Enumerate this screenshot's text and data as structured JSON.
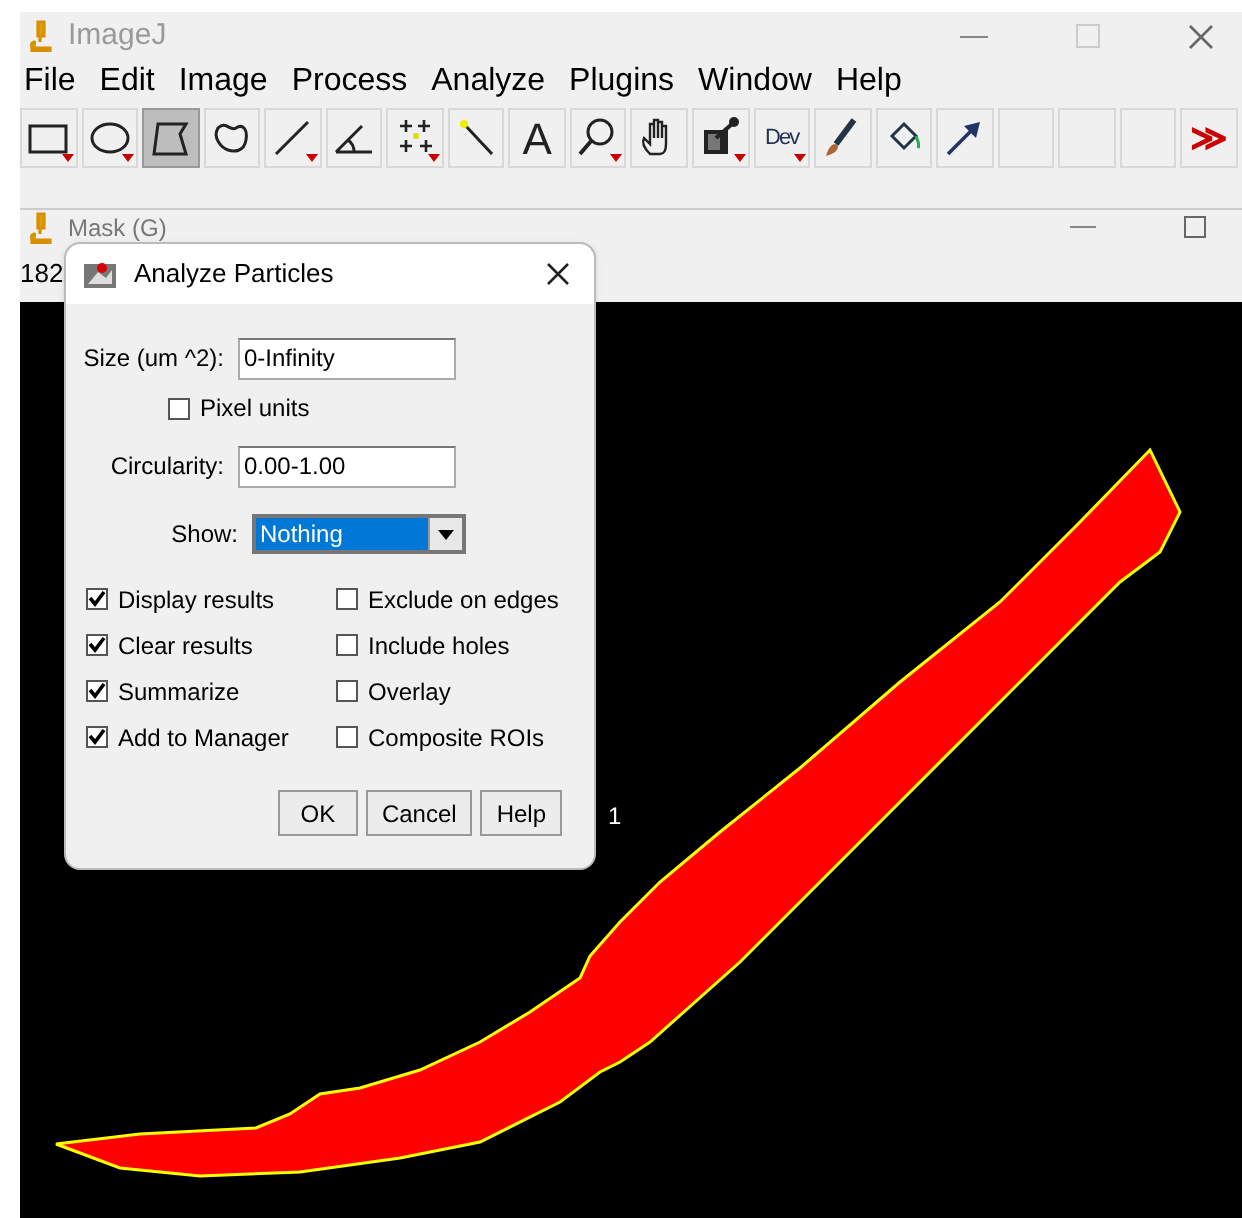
{
  "main_window": {
    "title": "ImageJ"
  },
  "menu": [
    "File",
    "Edit",
    "Image",
    "Process",
    "Analyze",
    "Plugins",
    "Window",
    "Help"
  ],
  "tools": [
    {
      "kind": "rectangle",
      "selected": false,
      "has_menu": true
    },
    {
      "kind": "oval",
      "selected": false,
      "has_menu": true
    },
    {
      "kind": "polygon",
      "selected": true,
      "has_menu": false
    },
    {
      "kind": "freehand",
      "selected": false,
      "has_menu": false
    },
    {
      "kind": "line",
      "selected": false,
      "has_menu": true
    },
    {
      "kind": "angle",
      "selected": false,
      "has_menu": false
    },
    {
      "kind": "points",
      "selected": false,
      "has_menu": true
    },
    {
      "kind": "wand",
      "selected": false,
      "has_menu": false
    },
    {
      "kind": "text",
      "label": "A",
      "selected": false,
      "has_menu": false
    },
    {
      "kind": "magnifier",
      "selected": false,
      "has_menu": true
    },
    {
      "kind": "hand",
      "selected": false,
      "has_menu": false
    },
    {
      "kind": "dropper",
      "selected": false,
      "has_menu": true
    },
    {
      "kind": "dev",
      "label": "Dev",
      "selected": false,
      "has_menu": true
    },
    {
      "kind": "brush",
      "selected": false,
      "has_menu": false
    },
    {
      "kind": "bucket",
      "selected": false,
      "has_menu": false
    },
    {
      "kind": "arrow",
      "selected": false,
      "has_menu": false
    },
    {
      "kind": "empty",
      "selected": false,
      "has_menu": false
    },
    {
      "kind": "empty",
      "selected": false,
      "has_menu": false
    },
    {
      "kind": "empty",
      "selected": false,
      "has_menu": false
    },
    {
      "kind": "more",
      "label": "≫",
      "selected": false,
      "has_menu": false
    }
  ],
  "image_window": {
    "title": "Mask (G)",
    "info": "182",
    "particle_label": "1"
  },
  "dialog": {
    "title": "Analyze Particles",
    "fields": [
      {
        "label": "Size (um ^2):",
        "value": "0-Infinity"
      },
      {
        "label": "Circularity:",
        "value": "0.00-1.00"
      }
    ],
    "pixel_units": {
      "label": "Pixel units",
      "checked": false
    },
    "show": {
      "label": "Show:",
      "value": "Nothing"
    },
    "options": [
      {
        "label": "Display results",
        "checked": true
      },
      {
        "label": "Exclude on edges",
        "checked": false
      },
      {
        "label": "Clear results",
        "checked": true
      },
      {
        "label": "Include holes",
        "checked": false
      },
      {
        "label": "Summarize",
        "checked": true
      },
      {
        "label": "Overlay",
        "checked": false
      },
      {
        "label": "Add to Manager",
        "checked": true
      },
      {
        "label": "Composite ROIs",
        "checked": false
      }
    ],
    "buttons": [
      "OK",
      "Cancel",
      "Help"
    ]
  }
}
